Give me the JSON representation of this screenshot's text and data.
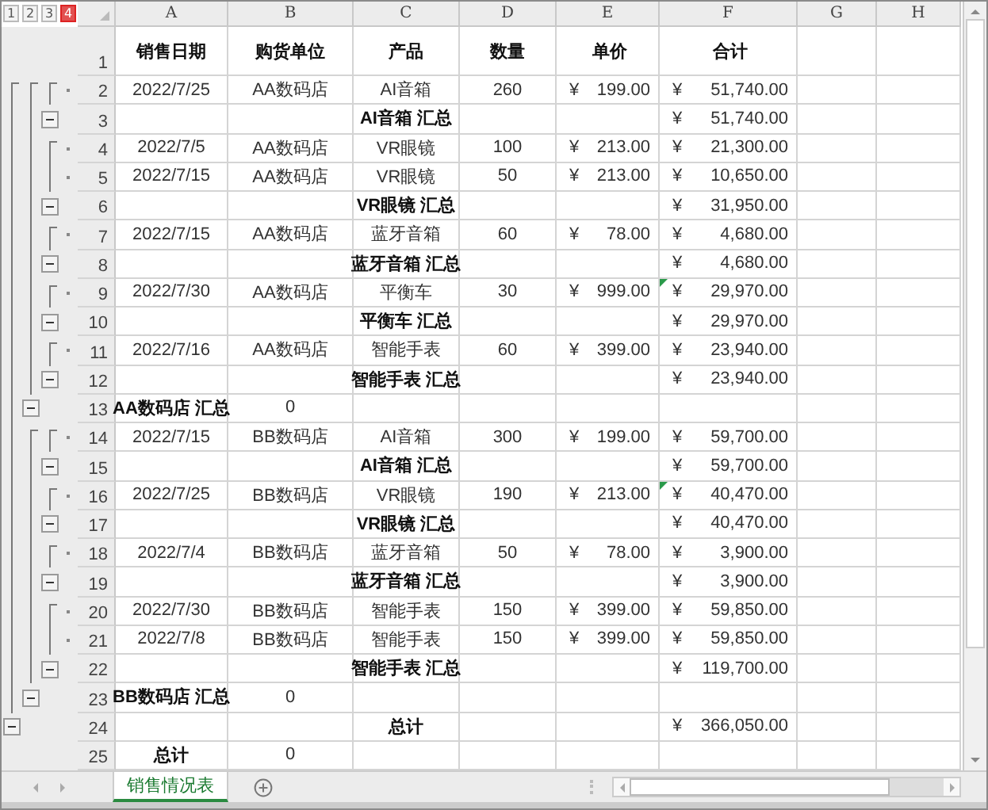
{
  "outline_levels": [
    {
      "label": "1",
      "selected": false
    },
    {
      "label": "2",
      "selected": false
    },
    {
      "label": "3",
      "selected": false
    },
    {
      "label": "4",
      "selected": true
    }
  ],
  "columns": [
    "A",
    "B",
    "C",
    "D",
    "E",
    "F",
    "G",
    "H"
  ],
  "rows": [
    {
      "number": "1",
      "kind": "header",
      "a": "销售日期",
      "b": "购货单位",
      "c": "产品",
      "d": "数量",
      "e": {
        "amount": "单价"
      },
      "f": {
        "amount": "合计"
      }
    },
    {
      "number": "2",
      "kind": "detail",
      "a": "2022/7/25",
      "b": "AA数码店",
      "c": "AI音箱",
      "d": "260",
      "e": {
        "symbol": "¥",
        "amount": "199.00"
      },
      "f": {
        "symbol": "¥",
        "amount": "51,740.00"
      }
    },
    {
      "number": "3",
      "kind": "subtotal",
      "expanded": true,
      "c": "AI音箱 汇总",
      "f": {
        "symbol": "¥",
        "amount": "51,740.00"
      }
    },
    {
      "number": "4",
      "kind": "detail",
      "a": "2022/7/5",
      "b": "AA数码店",
      "c": "VR眼镜",
      "d": "100",
      "e": {
        "symbol": "¥",
        "amount": "213.00"
      },
      "f": {
        "symbol": "¥",
        "amount": "21,300.00"
      }
    },
    {
      "number": "5",
      "kind": "detail",
      "a": "2022/7/15",
      "b": "AA数码店",
      "c": "VR眼镜",
      "d": "50",
      "e": {
        "symbol": "¥",
        "amount": "213.00"
      },
      "f": {
        "symbol": "¥",
        "amount": "10,650.00"
      }
    },
    {
      "number": "6",
      "kind": "subtotal",
      "expanded": true,
      "c": "VR眼镜 汇总",
      "f": {
        "symbol": "¥",
        "amount": "31,950.00"
      }
    },
    {
      "number": "7",
      "kind": "detail",
      "a": "2022/7/15",
      "b": "AA数码店",
      "c": "蓝牙音箱",
      "d": "60",
      "e": {
        "symbol": "¥",
        "amount": "78.00"
      },
      "f": {
        "symbol": "¥",
        "amount": "4,680.00"
      }
    },
    {
      "number": "8",
      "kind": "subtotal",
      "expanded": true,
      "c": "蓝牙音箱 汇总",
      "f": {
        "symbol": "¥",
        "amount": "4,680.00"
      }
    },
    {
      "number": "9",
      "kind": "detail",
      "flag": true,
      "a": "2022/7/30",
      "b": "AA数码店",
      "c": "平衡车",
      "d": "30",
      "e": {
        "symbol": "¥",
        "amount": "999.00"
      },
      "f": {
        "symbol": "¥",
        "amount": "29,970.00"
      }
    },
    {
      "number": "10",
      "kind": "subtotal",
      "expanded": true,
      "c": "平衡车 汇总",
      "f": {
        "symbol": "¥",
        "amount": "29,970.00"
      }
    },
    {
      "number": "11",
      "kind": "detail",
      "a": "2022/7/16",
      "b": "AA数码店",
      "c": "智能手表",
      "d": "60",
      "e": {
        "symbol": "¥",
        "amount": "399.00"
      },
      "f": {
        "symbol": "¥",
        "amount": "23,940.00"
      }
    },
    {
      "number": "12",
      "kind": "subtotal",
      "expanded": true,
      "c": "智能手表 汇总",
      "f": {
        "symbol": "¥",
        "amount": "23,940.00"
      }
    },
    {
      "number": "13",
      "kind": "store_total",
      "expanded": true,
      "a": "AA数码店 汇总",
      "b": "0"
    },
    {
      "number": "14",
      "kind": "detail",
      "a": "2022/7/15",
      "b": "BB数码店",
      "c": "AI音箱",
      "d": "300",
      "e": {
        "symbol": "¥",
        "amount": "199.00"
      },
      "f": {
        "symbol": "¥",
        "amount": "59,700.00"
      }
    },
    {
      "number": "15",
      "kind": "subtotal",
      "expanded": true,
      "c": "AI音箱 汇总",
      "f": {
        "symbol": "¥",
        "amount": "59,700.00"
      }
    },
    {
      "number": "16",
      "kind": "detail",
      "flag": true,
      "a": "2022/7/25",
      "b": "BB数码店",
      "c": "VR眼镜",
      "d": "190",
      "e": {
        "symbol": "¥",
        "amount": "213.00"
      },
      "f": {
        "symbol": "¥",
        "amount": "40,470.00"
      }
    },
    {
      "number": "17",
      "kind": "subtotal",
      "expanded": true,
      "c": "VR眼镜 汇总",
      "f": {
        "symbol": "¥",
        "amount": "40,470.00"
      }
    },
    {
      "number": "18",
      "kind": "detail",
      "a": "2022/7/4",
      "b": "BB数码店",
      "c": "蓝牙音箱",
      "d": "50",
      "e": {
        "symbol": "¥",
        "amount": "78.00"
      },
      "f": {
        "symbol": "¥",
        "amount": "3,900.00"
      }
    },
    {
      "number": "19",
      "kind": "subtotal",
      "expanded": true,
      "c": "蓝牙音箱 汇总",
      "f": {
        "symbol": "¥",
        "amount": "3,900.00"
      }
    },
    {
      "number": "20",
      "kind": "detail",
      "a": "2022/7/30",
      "b": "BB数码店",
      "c": "智能手表",
      "d": "150",
      "e": {
        "symbol": "¥",
        "amount": "399.00"
      },
      "f": {
        "symbol": "¥",
        "amount": "59,850.00"
      }
    },
    {
      "number": "21",
      "kind": "detail",
      "a": "2022/7/8",
      "b": "BB数码店",
      "c": "智能手表",
      "d": "150",
      "e": {
        "symbol": "¥",
        "amount": "399.00"
      },
      "f": {
        "symbol": "¥",
        "amount": "59,850.00"
      }
    },
    {
      "number": "22",
      "kind": "subtotal",
      "expanded": true,
      "c": "智能手表 汇总",
      "f": {
        "symbol": "¥",
        "amount": "119,700.00"
      }
    },
    {
      "number": "23",
      "kind": "store_total",
      "expanded": true,
      "a": "BB数码店 汇总",
      "b": "0"
    },
    {
      "number": "24",
      "kind": "grand_total",
      "expanded": true,
      "c": "总计",
      "f": {
        "symbol": "¥",
        "amount": "366,050.00"
      }
    },
    {
      "number": "25",
      "kind": "count_total",
      "a": "总计",
      "b": "0"
    }
  ],
  "sheet_tabs": [
    {
      "label": "销售情况表",
      "selected": true
    }
  ]
}
